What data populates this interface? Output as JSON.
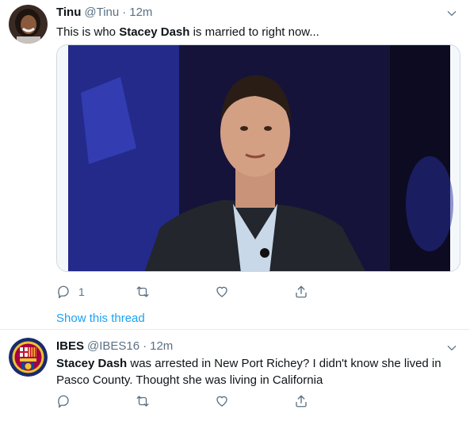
{
  "tweets": [
    {
      "name": "Tinu",
      "handle": "@Tinu",
      "dot": "·",
      "time": "12m",
      "text_pre": "This is who ",
      "text_bold": "Stacey Dash",
      "text_post": " is married to right now...",
      "actions": {
        "reply_count": "1"
      },
      "show_thread": "Show this thread"
    },
    {
      "name": "IBES",
      "handle": "@IBES16",
      "dot": "·",
      "time": "12m",
      "text_bold": "Stacey Dash",
      "text_post": " was arrested in New Port Richey? I didn't know she lived in Pasco County. Thought she was living in California"
    }
  ],
  "colors": {
    "link": "#1da1f2",
    "muted": "#5b7083",
    "border": "#e6ecf0"
  }
}
